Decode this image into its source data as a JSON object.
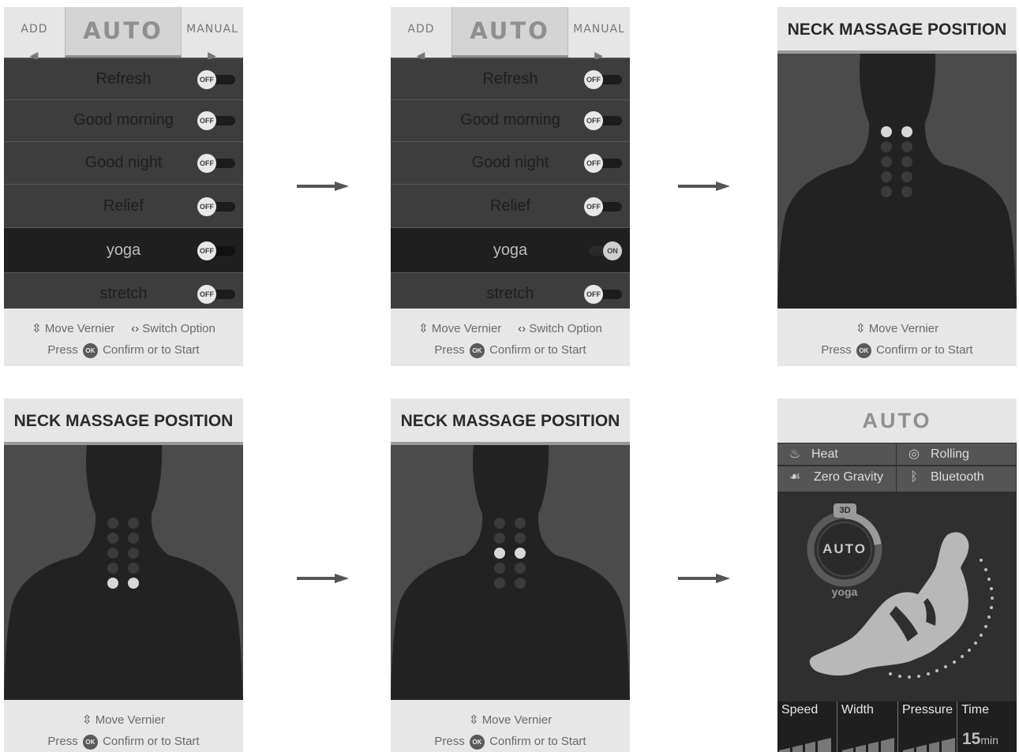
{
  "menu_screen": {
    "tabs": {
      "add": "ADD",
      "auto": "AUTO",
      "manual": "MANUAL",
      "left_arrow": "◀",
      "right_arrow": "▶"
    },
    "modes": [
      {
        "label": "Refresh",
        "toggle": "OFF"
      },
      {
        "label": "Good morning",
        "toggle": "OFF"
      },
      {
        "label": "Good night",
        "toggle": "OFF"
      },
      {
        "label": "Relief",
        "toggle": "OFF"
      },
      {
        "label": "yoga",
        "toggle": "OFF"
      },
      {
        "label": "stretch",
        "toggle": "OFF"
      }
    ],
    "selected_mode": "yoga",
    "after_toggle_state": "ON",
    "hint_move": "Move Vernier",
    "hint_switch": "Switch Option",
    "hint_press": "Press",
    "hint_confirm": "Confirm or to Start",
    "ok_badge": "OK"
  },
  "neck_screen": {
    "title": "NECK MASSAGE POSITION",
    "hint_move": "Move Vernier",
    "hint_press": "Press",
    "hint_confirm": "Confirm or to Start",
    "ok_badge": "OK"
  },
  "auto_screen": {
    "title": "AUTO",
    "features": [
      {
        "icon": "flame-icon",
        "label": "Heat"
      },
      {
        "icon": "roller-icon",
        "label": "Rolling"
      },
      {
        "icon": "zero-gravity-icon",
        "label": "Zero Gravity"
      },
      {
        "icon": "bluetooth-icon",
        "label": "Bluetooth"
      }
    ],
    "mode_badge": "3D",
    "mode_ring": "AUTO",
    "mode_name": "yoga",
    "stats": [
      {
        "label": "Speed"
      },
      {
        "label": "Width"
      },
      {
        "label": "Pressure"
      },
      {
        "label": "Time",
        "value": "15",
        "unit": "min"
      }
    ]
  },
  "colors": {
    "dark_panel": "#3d3d3d",
    "selected_row": "#1f1f1f",
    "header_bg": "#e6e6e6",
    "node_active": "#d8d8d8"
  }
}
